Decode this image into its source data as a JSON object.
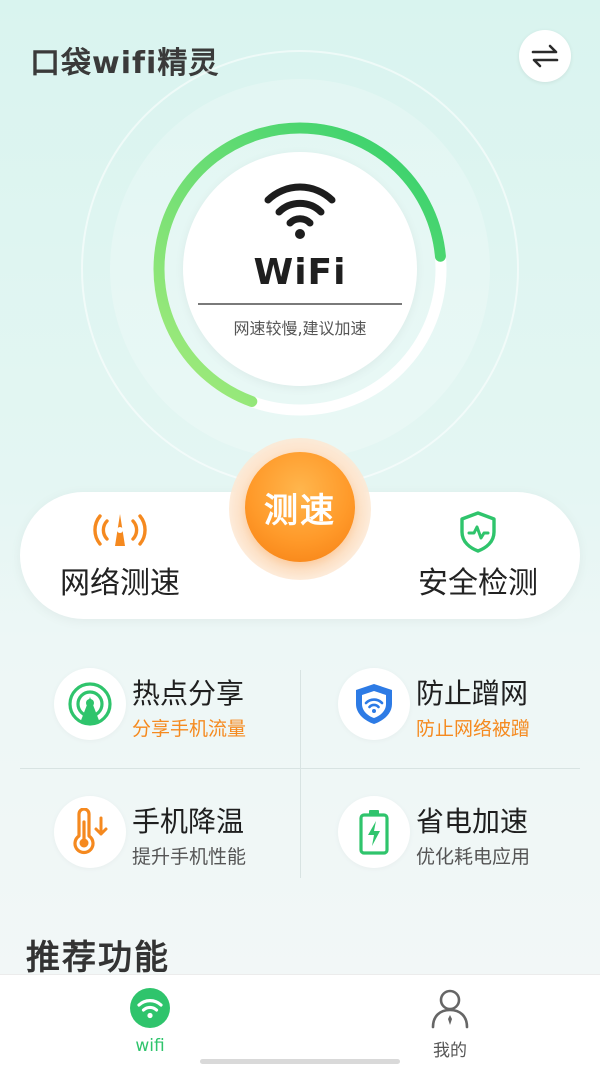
{
  "app": {
    "title": "口袋wifi精灵"
  },
  "gauge": {
    "label": "WiFi",
    "status": "网速较慢,建议加速",
    "level": 0.68,
    "colors": {
      "start": "#a8ec7c",
      "end": "#2fcf6c",
      "track": "#ffffff"
    }
  },
  "speed_test_button": {
    "label": "测速",
    "color": "#ff9a2a"
  },
  "quick_actions": [
    {
      "label": "网络测速",
      "icon": "signal-tower-icon",
      "color": "#f5891f"
    },
    {
      "label": "安全检测",
      "icon": "shield-check-icon",
      "color": "#2fc46c"
    }
  ],
  "tools": [
    {
      "name": "热点分享",
      "desc": "分享手机流量",
      "icon": "hotspot-icon",
      "desc_color": "#f58a1f"
    },
    {
      "name": "防止蹭网",
      "desc": "防止网络被蹭",
      "icon": "shield-wifi-icon",
      "desc_color": "#f58a1f"
    },
    {
      "name": "手机降温",
      "desc": "提升手机性能",
      "icon": "thermometer-icon",
      "desc_color": "#555555"
    },
    {
      "name": "省电加速",
      "desc": "优化耗电应用",
      "icon": "battery-charge-icon",
      "desc_color": "#555555"
    }
  ],
  "section": {
    "title": "推荐功能"
  },
  "tabbar": {
    "items": [
      {
        "label": "wifi",
        "icon": "wifi-icon",
        "active": true,
        "color": "#2fc46c"
      },
      {
        "label": "我的",
        "icon": "user-icon",
        "active": false,
        "color": "#555555"
      }
    ]
  }
}
